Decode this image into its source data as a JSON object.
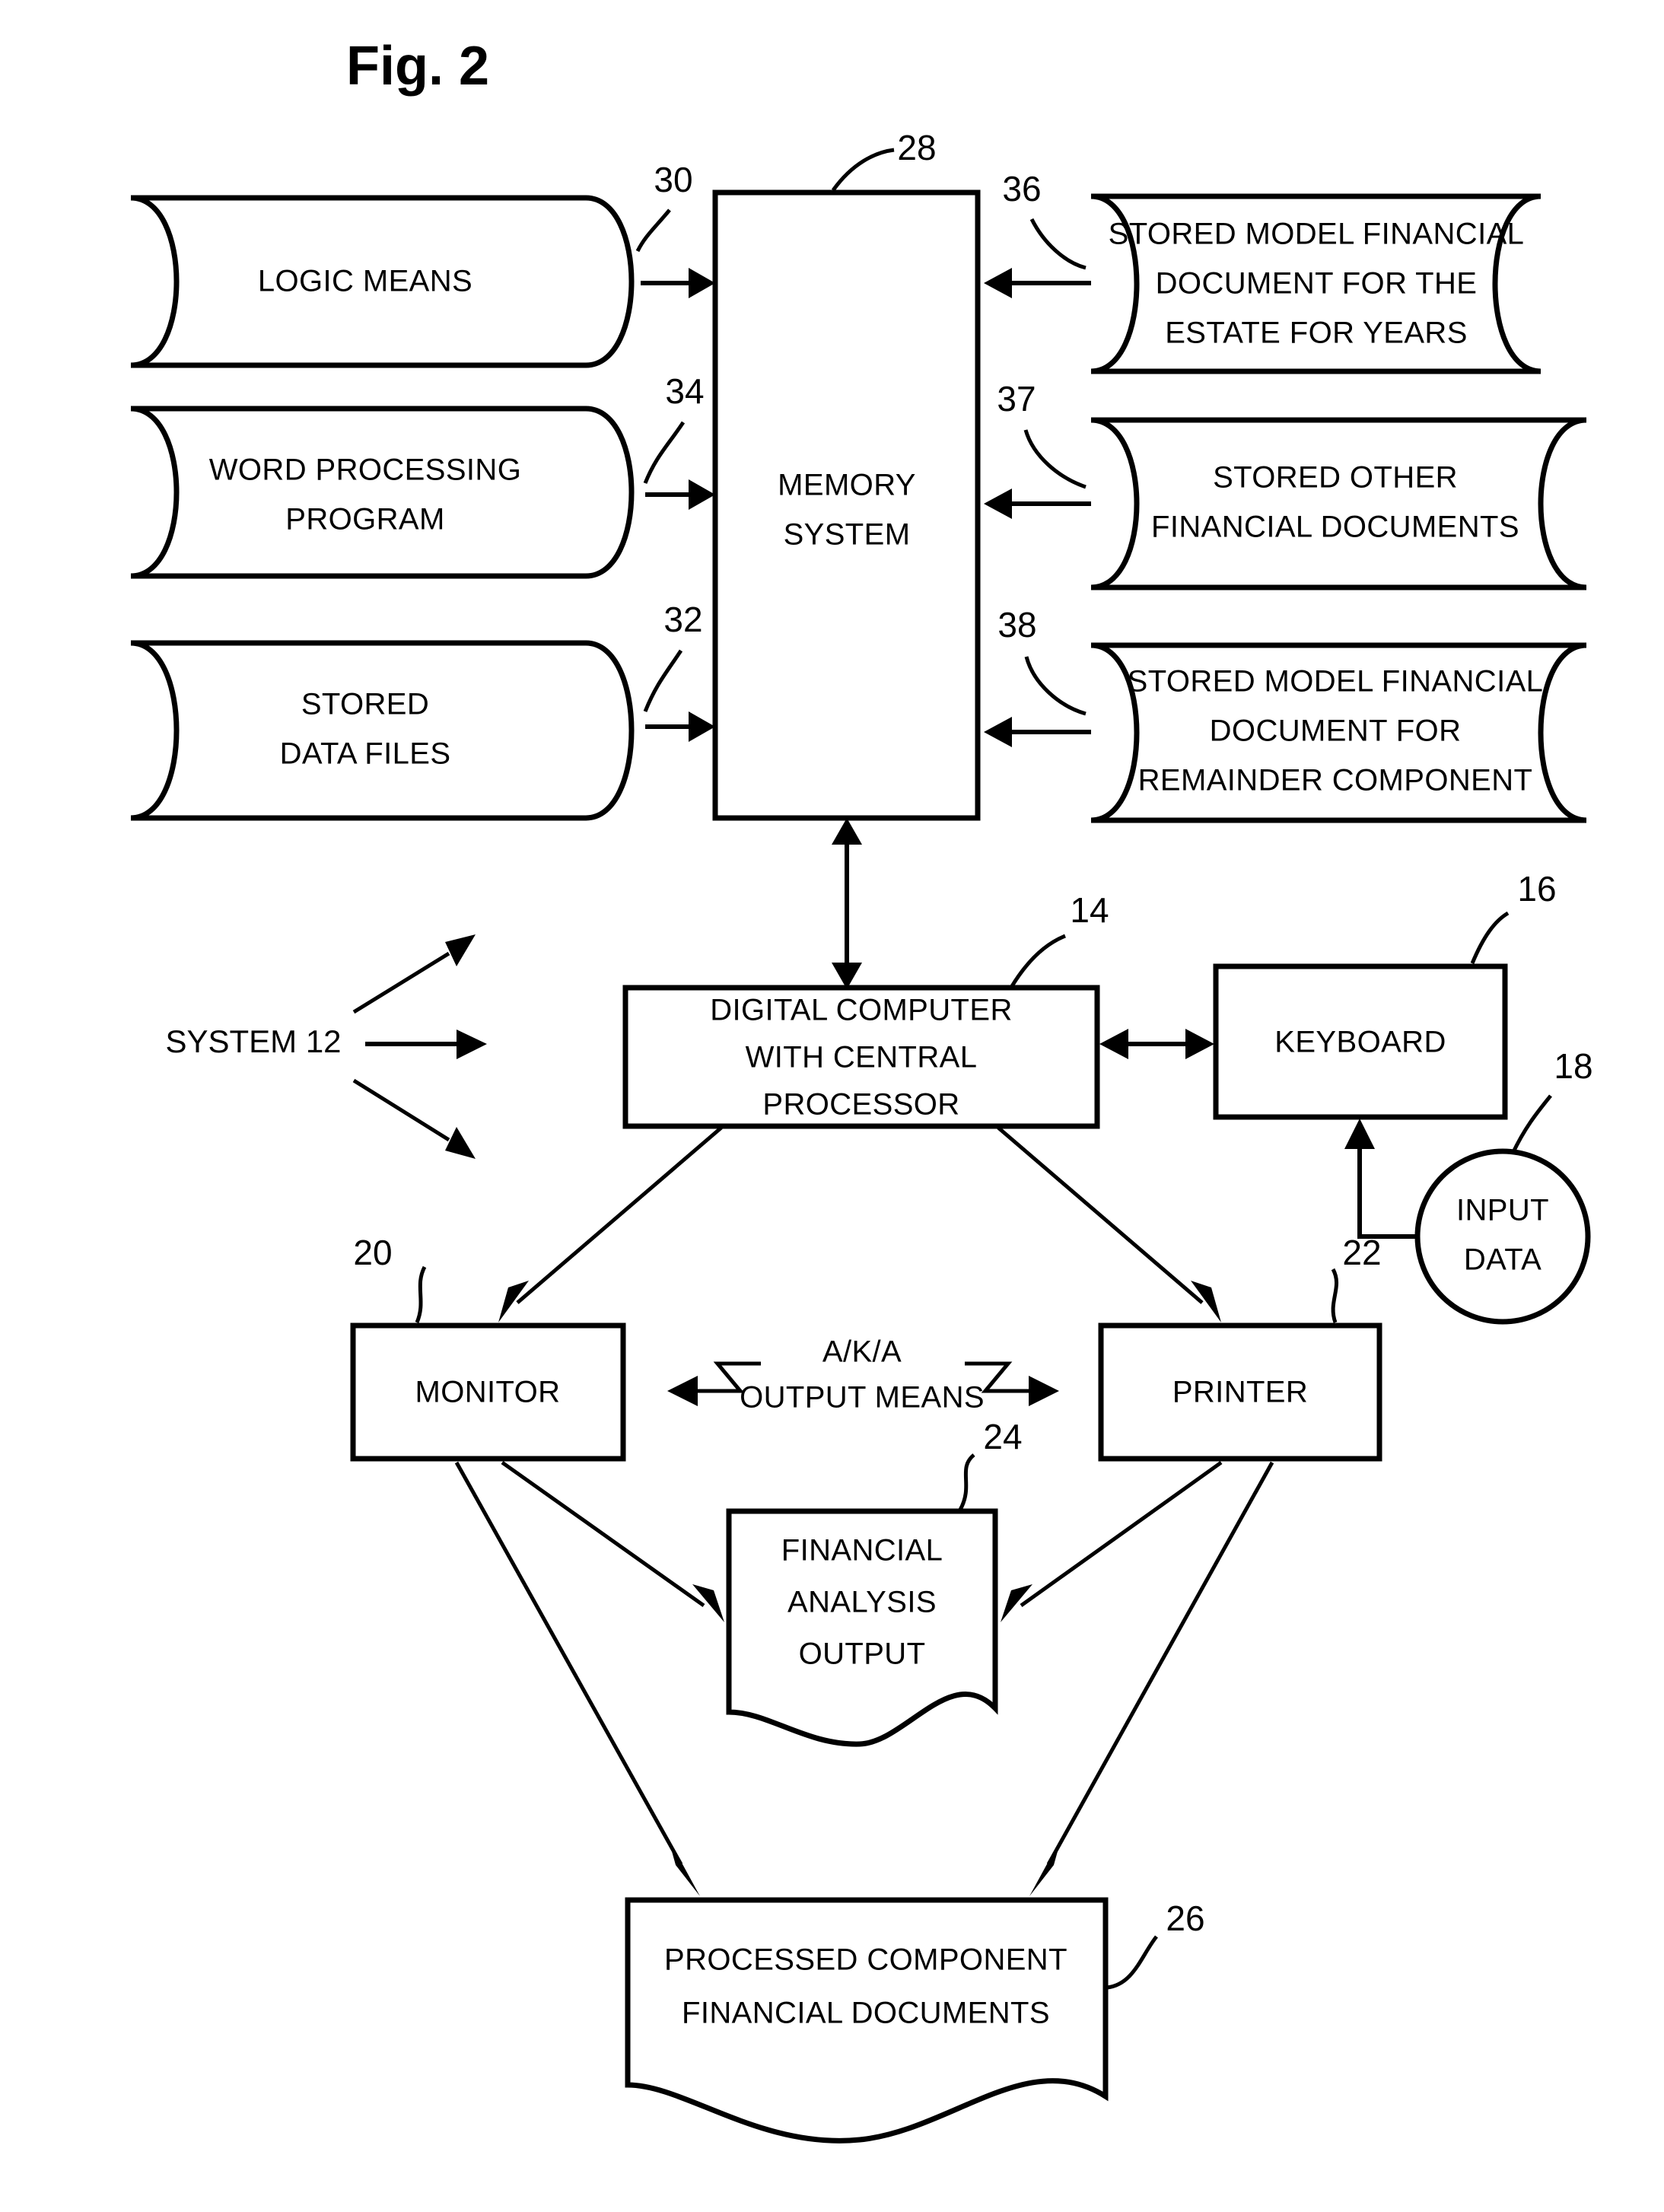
{
  "figure": {
    "title": "Fig. 2"
  },
  "nodes": {
    "logic_means": {
      "label_lines": [
        "LOGIC MEANS"
      ],
      "ref": "30",
      "shape": "cylinder-left"
    },
    "word_processing_program": {
      "label_lines": [
        "WORD PROCESSING",
        "PROGRAM"
      ],
      "ref": "34",
      "shape": "cylinder-left"
    },
    "stored_data_files": {
      "label_lines": [
        "STORED",
        "DATA FILES"
      ],
      "ref": "32",
      "shape": "cylinder-left"
    },
    "memory_system": {
      "label_lines": [
        "MEMORY",
        "SYSTEM"
      ],
      "ref": "28",
      "shape": "rect"
    },
    "stored_model_estate_for_years": {
      "label_lines": [
        "STORED MODEL FINANCIAL",
        "DOCUMENT FOR THE",
        "ESTATE FOR YEARS"
      ],
      "ref": "36",
      "shape": "cylinder-right"
    },
    "stored_other_financial_documents": {
      "label_lines": [
        "STORED OTHER",
        "FINANCIAL DOCUMENTS"
      ],
      "ref": "37",
      "shape": "cylinder-right"
    },
    "stored_model_remainder_component": {
      "label_lines": [
        "STORED MODEL FINANCIAL",
        "DOCUMENT FOR",
        "REMAINDER COMPONENT"
      ],
      "ref": "38",
      "shape": "cylinder-right"
    },
    "digital_computer": {
      "label_lines": [
        "DIGITAL COMPUTER",
        "WITH CENTRAL",
        "PROCESSOR"
      ],
      "ref": "14",
      "shape": "rect"
    },
    "keyboard": {
      "label_lines": [
        "KEYBOARD"
      ],
      "ref": "16",
      "shape": "rect"
    },
    "input_data": {
      "label_lines": [
        "INPUT",
        "DATA"
      ],
      "ref": "18",
      "shape": "circle"
    },
    "monitor": {
      "label_lines": [
        "MONITOR"
      ],
      "ref": "20",
      "shape": "rect"
    },
    "printer": {
      "label_lines": [
        "PRINTER"
      ],
      "ref": "22",
      "shape": "rect"
    },
    "financial_analysis_output": {
      "label_lines": [
        "FINANCIAL",
        "ANALYSIS",
        "OUTPUT"
      ],
      "ref": "24",
      "shape": "document"
    },
    "processed_component_documents": {
      "label_lines": [
        "PROCESSED COMPONENT",
        "FINANCIAL DOCUMENTS"
      ],
      "ref": "26",
      "shape": "document"
    }
  },
  "annotations": {
    "system_label": "SYSTEM 12",
    "output_means_line1": "A/K/A",
    "output_means_line2": "OUTPUT MEANS"
  },
  "style": {
    "stroke": "#000000",
    "background": "#ffffff"
  }
}
